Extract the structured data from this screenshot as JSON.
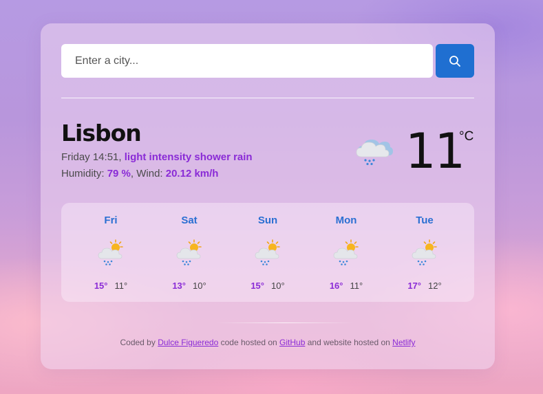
{
  "search": {
    "placeholder": "Enter a city..."
  },
  "current": {
    "city": "Lisbon",
    "datetime": "Friday 14:51",
    "description": "light intensity shower rain",
    "humidity_label": "Humidity:",
    "humidity": "79 %",
    "wind_label": "Wind:",
    "wind": "20.12 km/h",
    "temperature": "11",
    "unit": "°C",
    "icon": "rain-cloud-icon"
  },
  "forecast": [
    {
      "day": "Fri",
      "max": "15°",
      "min": "11°",
      "icon": "sun-cloud-rain-icon"
    },
    {
      "day": "Sat",
      "max": "13°",
      "min": "10°",
      "icon": "sun-cloud-rain-icon"
    },
    {
      "day": "Sun",
      "max": "15°",
      "min": "10°",
      "icon": "sun-cloud-rain-icon"
    },
    {
      "day": "Mon",
      "max": "16°",
      "min": "11°",
      "icon": "sun-cloud-rain-icon"
    },
    {
      "day": "Tue",
      "max": "17°",
      "min": "12°",
      "icon": "sun-cloud-rain-icon"
    }
  ],
  "footer": {
    "coded_by": "Coded by",
    "author": "Dulce Figueredo",
    "code_hosted": "code hosted on",
    "github": "GitHub",
    "website_hosted": "and website hosted on",
    "netlify": "Netlify"
  },
  "colors": {
    "accent": "#8a2bd6",
    "button": "#1f6fd1",
    "day_name": "#2a6fd2"
  }
}
